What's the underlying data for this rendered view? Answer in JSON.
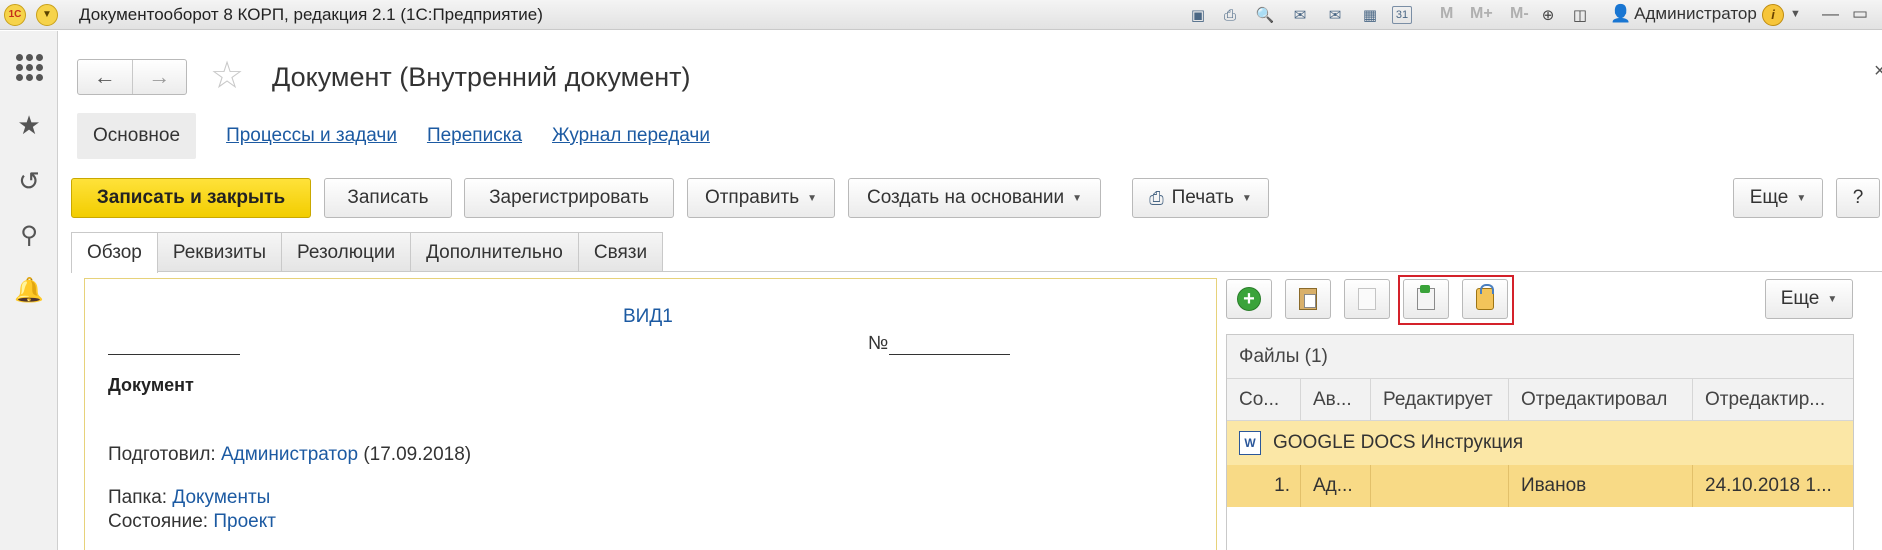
{
  "titlebar": {
    "logo": "1С",
    "app_title": "Документооборот 8 КОРП, редакция 2.1  (1С:Предприятие)",
    "tools": [
      "save-icon",
      "print-icon",
      "preview-icon",
      "mail-upload-icon",
      "mail-download-icon",
      "calculator-icon",
      "calendar-icon"
    ],
    "calendar_day": "31",
    "memory_buttons": [
      "M",
      "M+",
      "M-"
    ],
    "user": "Администратор",
    "user_icon": "user-icon",
    "info_glyph": "i"
  },
  "sidebar": {
    "icons": [
      "apps-grid-icon",
      "favorites-star-icon",
      "history-icon",
      "search-icon",
      "notifications-bell-icon"
    ]
  },
  "header": {
    "title": "Документ (Внутренний документ)"
  },
  "sections": {
    "main": "Основное",
    "processes": "Процессы и задачи",
    "correspondence": "Переписка",
    "transfer_log": "Журнал передачи"
  },
  "commands": {
    "save_close": "Записать и закрыть",
    "save": "Записать",
    "register": "Зарегистрировать",
    "send": "Отправить",
    "create_based": "Создать на основании",
    "print": "Печать",
    "more": "Еще",
    "help": "?"
  },
  "tabs": {
    "overview": "Обзор",
    "requisites": "Реквизиты",
    "resolutions": "Резолюции",
    "additional": "Дополнительно",
    "links": "Связи"
  },
  "document": {
    "kind": "ВИД1",
    "number_label": "№",
    "title": "Документ",
    "prepared_label": "Подготовил:",
    "prepared_by": "Администратор",
    "prepared_date": "(17.09.2018)",
    "folder_label": "Папка:",
    "folder": "Документы",
    "state_label": "Состояние:",
    "state": "Проект"
  },
  "files": {
    "toolbar_icons": [
      "add-file-icon",
      "paste-file-icon",
      "file-icon",
      "file-export-icon",
      "file-import-icon"
    ],
    "more": "Еще",
    "header": "Файлы (1)",
    "columns": [
      "Со...",
      "Ав...",
      "Редактирует",
      "Отредактировал",
      "Отредактир..."
    ],
    "group_name": "GOOGLE DOCS Инструкция",
    "group_icon_text": "W",
    "row": [
      "1.",
      "Ад...",
      "",
      "Иванов",
      "24.10.2018 1..."
    ]
  },
  "colors": {
    "accent_yellow": "#f2cd00",
    "link_blue": "#1c5aa2",
    "selection": "#f8da86",
    "highlight_red": "#d4212a"
  }
}
